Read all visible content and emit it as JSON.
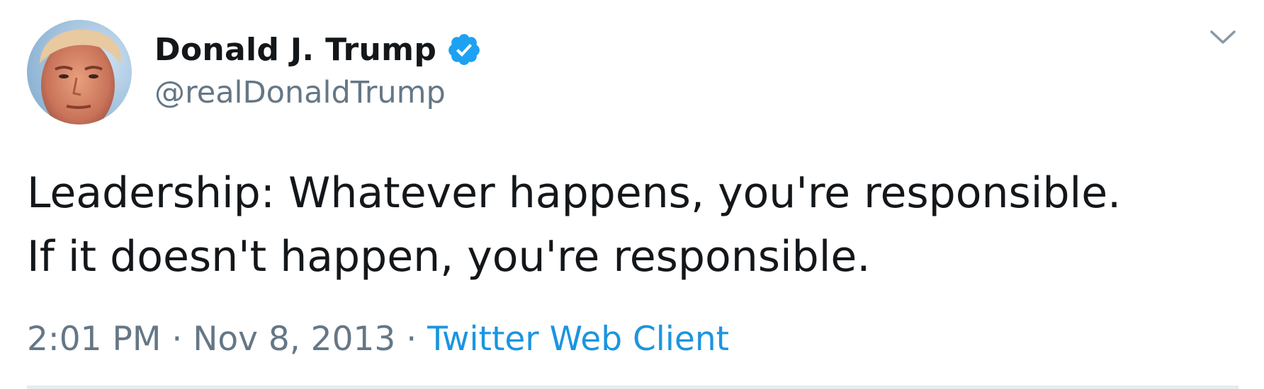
{
  "user": {
    "display_name": "Donald J. Trump",
    "handle": "@realDonaldTrump",
    "verified": true,
    "avatar_icon": "profile-photo"
  },
  "tweet": {
    "lines": [
      "Leadership: Whatever happens, you're responsible.",
      "If it doesn't happen, you're responsible."
    ]
  },
  "meta": {
    "time": "2:01 PM",
    "separator": " · ",
    "date": "Nov 8, 2013",
    "source": "Twitter Web Client"
  },
  "icons": {
    "verified": "verified-badge-icon",
    "menu": "chevron-down-icon"
  },
  "colors": {
    "text": "#14171a",
    "secondary": "#657786",
    "link": "#1b95e0",
    "verified_blue": "#1da1f2",
    "divider": "#e6ecf0"
  }
}
